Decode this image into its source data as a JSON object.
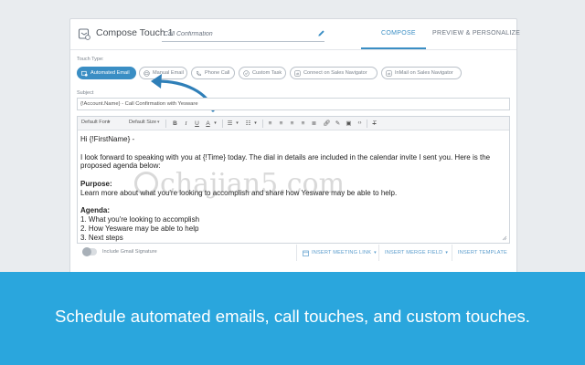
{
  "header": {
    "title": "Compose Touch 1",
    "title_input_value": "Call Confirmation",
    "tabs": [
      {
        "label": "COMPOSE",
        "active": true
      },
      {
        "label": "PREVIEW & PERSONALIZE",
        "active": false
      }
    ]
  },
  "touch_type": {
    "label": "Touch Type:",
    "options": [
      {
        "label": "Automated Email",
        "icon": "gear-mail-icon",
        "active": true
      },
      {
        "label": "Manual Email",
        "icon": "mail-icon",
        "active": false
      },
      {
        "label": "Phone Call",
        "icon": "phone-icon",
        "active": false
      },
      {
        "label": "Custom Task",
        "icon": "check-icon",
        "active": false
      },
      {
        "label": "Connect on Sales Navigator",
        "icon": "linkedin-icon",
        "active": false
      },
      {
        "label": "InMail on Sales Navigator",
        "icon": "linkedin-icon",
        "active": false
      }
    ]
  },
  "subject": {
    "label": "Subject",
    "value": "{!Account.Name} - Call Confirmation with Yesware"
  },
  "toolbar": {
    "font_select": "Default Font",
    "size_select": "Default Size",
    "buttons": [
      "B",
      "I",
      "U",
      "A",
      "ordered-list",
      "unordered-list",
      "align-left",
      "align-center",
      "align-right",
      "justify",
      "link",
      "image",
      "code",
      "clear-format"
    ]
  },
  "body": {
    "greeting": "Hi {!FirstName} -",
    "intro": "I look forward to speaking with you at {!Time} today. The dial in details are included in the calendar invite I sent you. Here is the proposed agenda below:",
    "purpose_heading": "Purpose:",
    "purpose_text": "Learn more about what you're looking to accomplish and share how Yesware may be able to help.",
    "agenda_heading": "Agenda:",
    "agenda_items": [
      "1. What you're looking to accomplish",
      "2. How Yesware may be able to help",
      "3. Next steps"
    ]
  },
  "footer": {
    "gmail_signature_label": "Include Gmail Signature",
    "insert_meeting_link": "INSERT MEETING LINK",
    "insert_merge_field": "INSERT MERGE FIELD",
    "insert_template": "INSERT TEMPLATE"
  },
  "banner": {
    "text": "Schedule automated emails, call touches, and custom touches."
  },
  "watermark": {
    "text": "chajian5.com"
  },
  "colors": {
    "accent": "#3a8ec4",
    "banner": "#2aa6dd",
    "link_button": "#5a9ccc"
  }
}
